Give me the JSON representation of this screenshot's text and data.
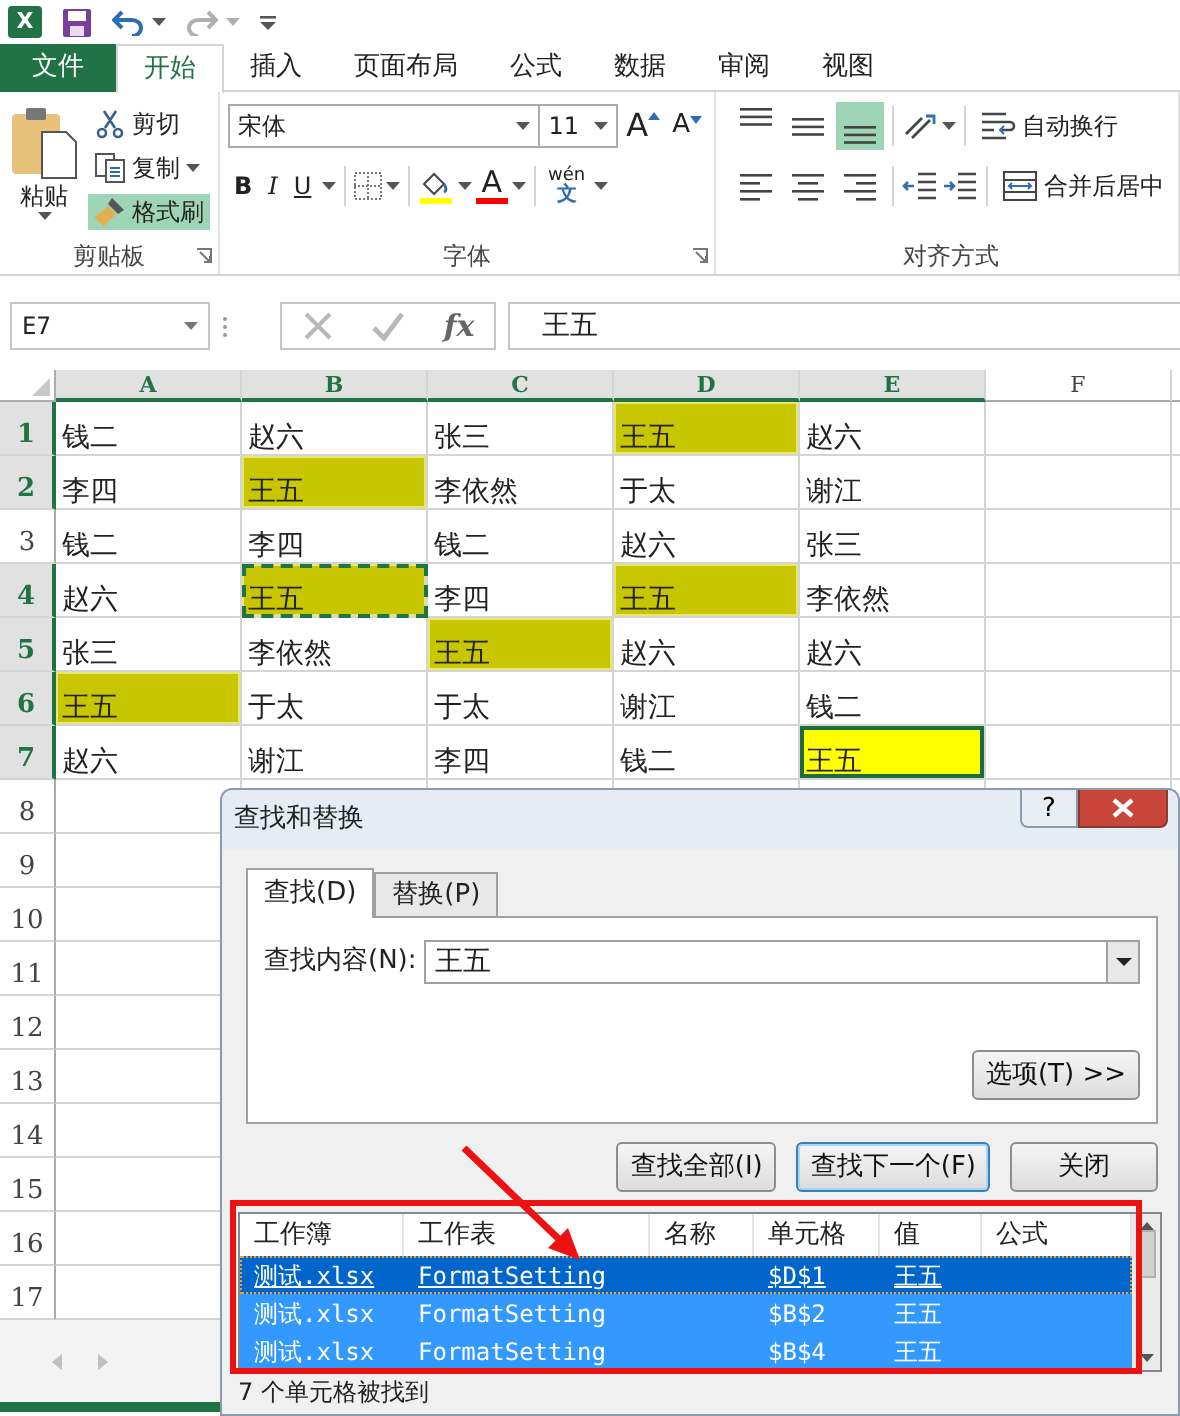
{
  "quick_access": {
    "logo": "X"
  },
  "ribbon_tabs": [
    {
      "label": "文件",
      "kind": "file",
      "selected": false
    },
    {
      "label": "开始",
      "kind": "tab",
      "selected": true
    },
    {
      "label": "插入",
      "kind": "tab",
      "selected": false
    },
    {
      "label": "页面布局",
      "kind": "tab",
      "selected": false
    },
    {
      "label": "公式",
      "kind": "tab",
      "selected": false
    },
    {
      "label": "数据",
      "kind": "tab",
      "selected": false
    },
    {
      "label": "审阅",
      "kind": "tab",
      "selected": false
    },
    {
      "label": "视图",
      "kind": "tab",
      "selected": false
    }
  ],
  "clipboard": {
    "label": "剪贴板",
    "paste": "粘贴",
    "cut": "剪切",
    "copy": "复制",
    "format_painter": {
      "label": "格式刷",
      "on": true
    }
  },
  "font": {
    "label": "字体",
    "name": "宋体",
    "size": "11",
    "grow": "A",
    "shrink": "A",
    "bold": "B",
    "italic": "I",
    "underline": "U",
    "font_color": "A",
    "phonetic_top": "wén",
    "phonetic_bottom": "文"
  },
  "alignment": {
    "label": "对齐方式",
    "vertical": [
      {
        "kind": "top",
        "selected": false
      },
      {
        "kind": "middle",
        "selected": false
      },
      {
        "kind": "bottom",
        "selected": true
      }
    ],
    "wrap_text": "自动换行",
    "merge_center": "合并后居中"
  },
  "formula_bar": {
    "name_box": "E7",
    "fx": "fx",
    "value": "王五"
  },
  "columns": [
    {
      "label": "A",
      "selected": true
    },
    {
      "label": "B",
      "selected": true
    },
    {
      "label": "C",
      "selected": true
    },
    {
      "label": "D",
      "selected": true
    },
    {
      "label": "E",
      "selected": true
    },
    {
      "label": "F",
      "selected": false
    }
  ],
  "rows": [
    {
      "number": "1",
      "selected": true,
      "cells": [
        {
          "text": "钱二",
          "highlighted": false,
          "selected": false,
          "marquee": false
        },
        {
          "text": "赵六",
          "highlighted": false,
          "selected": false,
          "marquee": false
        },
        {
          "text": "张三",
          "highlighted": false,
          "selected": false,
          "marquee": false
        },
        {
          "text": "王五",
          "highlighted": true,
          "selected": false,
          "marquee": false
        },
        {
          "text": "赵六",
          "highlighted": false,
          "selected": false,
          "marquee": false
        }
      ]
    },
    {
      "number": "2",
      "selected": true,
      "cells": [
        {
          "text": "李四",
          "highlighted": false,
          "selected": false,
          "marquee": false
        },
        {
          "text": "王五",
          "highlighted": true,
          "selected": false,
          "marquee": false
        },
        {
          "text": "李依然",
          "highlighted": false,
          "selected": false,
          "marquee": false
        },
        {
          "text": "于太",
          "highlighted": false,
          "selected": false,
          "marquee": false
        },
        {
          "text": "谢江",
          "highlighted": false,
          "selected": false,
          "marquee": false
        }
      ]
    },
    {
      "number": "3",
      "selected": false,
      "cells": [
        {
          "text": "钱二",
          "highlighted": false,
          "selected": false,
          "marquee": false
        },
        {
          "text": "李四",
          "highlighted": false,
          "selected": false,
          "marquee": false
        },
        {
          "text": "钱二",
          "highlighted": false,
          "selected": false,
          "marquee": false
        },
        {
          "text": "赵六",
          "highlighted": false,
          "selected": false,
          "marquee": false
        },
        {
          "text": "张三",
          "highlighted": false,
          "selected": false,
          "marquee": false
        }
      ]
    },
    {
      "number": "4",
      "selected": true,
      "cells": [
        {
          "text": "赵六",
          "highlighted": false,
          "selected": false,
          "marquee": false
        },
        {
          "text": "王五",
          "highlighted": true,
          "selected": false,
          "marquee": true
        },
        {
          "text": "李四",
          "highlighted": false,
          "selected": false,
          "marquee": false
        },
        {
          "text": "王五",
          "highlighted": true,
          "selected": false,
          "marquee": false
        },
        {
          "text": "李依然",
          "highlighted": false,
          "selected": false,
          "marquee": false
        }
      ]
    },
    {
      "number": "5",
      "selected": true,
      "cells": [
        {
          "text": "张三",
          "highlighted": false,
          "selected": false,
          "marquee": false
        },
        {
          "text": "李依然",
          "highlighted": false,
          "selected": false,
          "marquee": false
        },
        {
          "text": "王五",
          "highlighted": true,
          "selected": false,
          "marquee": false
        },
        {
          "text": "赵六",
          "highlighted": false,
          "selected": false,
          "marquee": false
        },
        {
          "text": "赵六",
          "highlighted": false,
          "selected": false,
          "marquee": false
        }
      ]
    },
    {
      "number": "6",
      "selected": true,
      "cells": [
        {
          "text": "王五",
          "highlighted": true,
          "selected": false,
          "marquee": false
        },
        {
          "text": "于太",
          "highlighted": false,
          "selected": false,
          "marquee": false
        },
        {
          "text": "于太",
          "highlighted": false,
          "selected": false,
          "marquee": false
        },
        {
          "text": "谢江",
          "highlighted": false,
          "selected": false,
          "marquee": false
        },
        {
          "text": "钱二",
          "highlighted": false,
          "selected": false,
          "marquee": false
        }
      ]
    },
    {
      "number": "7",
      "selected": true,
      "cells": [
        {
          "text": "赵六",
          "highlighted": false,
          "selected": false,
          "marquee": false
        },
        {
          "text": "谢江",
          "highlighted": false,
          "selected": false,
          "marquee": false
        },
        {
          "text": "李四",
          "highlighted": false,
          "selected": false,
          "marquee": false
        },
        {
          "text": "钱二",
          "highlighted": false,
          "selected": false,
          "marquee": false
        },
        {
          "text": "王五",
          "highlighted": true,
          "selected": true,
          "marquee": false
        }
      ]
    },
    {
      "number": "8",
      "selected": false
    },
    {
      "number": "9",
      "selected": false
    },
    {
      "number": "10",
      "selected": false
    },
    {
      "number": "11",
      "selected": false
    },
    {
      "number": "12",
      "selected": false
    },
    {
      "number": "13",
      "selected": false
    },
    {
      "number": "14",
      "selected": false
    },
    {
      "number": "15",
      "selected": false
    },
    {
      "number": "16",
      "selected": false
    },
    {
      "number": "17",
      "selected": false
    }
  ],
  "dialog": {
    "title": "查找和替换",
    "help": "?",
    "tabs": [
      {
        "label": "查找(D)",
        "selected": true
      },
      {
        "label": "替换(P)",
        "selected": false
      }
    ],
    "find_label": "查找内容(N):",
    "find_value": "王五",
    "options": "选项(T) >>",
    "buttons": [
      {
        "label": "查找全部(I)",
        "default": false
      },
      {
        "label": "查找下一个(F)",
        "default": true
      },
      {
        "label": "关闭",
        "default": false
      }
    ],
    "results": {
      "columns": [
        "工作簿",
        "工作表",
        "名称",
        "单元格",
        "值",
        "公式"
      ],
      "rows": [
        {
          "workbook": "测试.xlsx",
          "sheet": "FormatSetting",
          "cell": "$D$1",
          "value": "王五",
          "selected": true,
          "focused": true
        },
        {
          "workbook": "测试.xlsx",
          "sheet": "FormatSetting",
          "cell": "$B$2",
          "value": "王五",
          "selected": true,
          "focused": false
        },
        {
          "workbook": "测试.xlsx",
          "sheet": "FormatSetting",
          "cell": "$B$4",
          "value": "王五",
          "selected": true,
          "focused": false
        }
      ]
    },
    "status": "7 个单元格被找到"
  }
}
